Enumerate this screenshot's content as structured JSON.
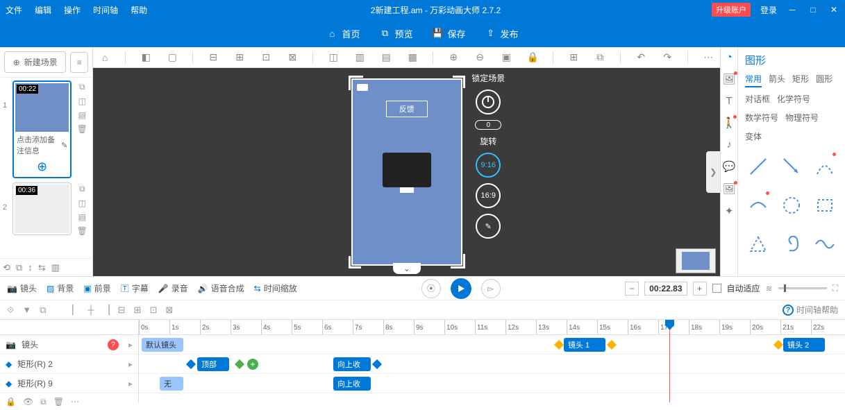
{
  "menu": {
    "file": "文件",
    "edit": "编辑",
    "action": "操作",
    "timeline_menu": "时间轴",
    "help": "帮助"
  },
  "title_doc": "2新建工程.am - 万彩动画大师 2.7.2",
  "upgrade": "升级账户",
  "login": "登录",
  "maintb": {
    "home": "首页",
    "preview": "预览",
    "save": "保存",
    "publish": "发布"
  },
  "scene": {
    "new": "新建场景",
    "items": [
      {
        "time": "00:22",
        "note": "点击添加备注信息"
      },
      {
        "time": "00:36",
        "note": ""
      }
    ]
  },
  "canvas": {
    "lock": "锁定场景",
    "rotate": "旋转",
    "rotate_val": "0",
    "ratio1": "9:16",
    "ratio2": "16:9",
    "feedback": "反馈"
  },
  "props": {
    "title": "图形",
    "tabs": [
      "常用",
      "箭头",
      "矩形",
      "圆形",
      "对话框",
      "化学符号",
      "数学符号",
      "物理符号",
      "变体"
    ]
  },
  "tlbar": {
    "camera": "镜头",
    "bg": "背景",
    "fg": "前景",
    "sub": "字幕",
    "rec": "录音",
    "tts": "语音合成",
    "tscale": "时间缩放",
    "time": "00:22.83",
    "auto": "自动适应",
    "help": "时间轴帮助"
  },
  "tracks": {
    "camera": "镜头",
    "rect2": "矩形(R) 2",
    "rect9": "矩形(R) 9",
    "default_cam": "默认镜头",
    "cam1": "镜头 1",
    "cam2": "镜头 2",
    "top": "顶部",
    "up": "向上收",
    "none": "无"
  },
  "ruler": [
    "0s",
    "1s",
    "2s",
    "3s",
    "4s",
    "5s",
    "6s",
    "7s",
    "8s",
    "9s",
    "10s",
    "11s",
    "12s",
    "13s",
    "14s",
    "15s",
    "16s",
    "17s",
    "18s",
    "19s",
    "20s",
    "21s",
    "22s"
  ]
}
